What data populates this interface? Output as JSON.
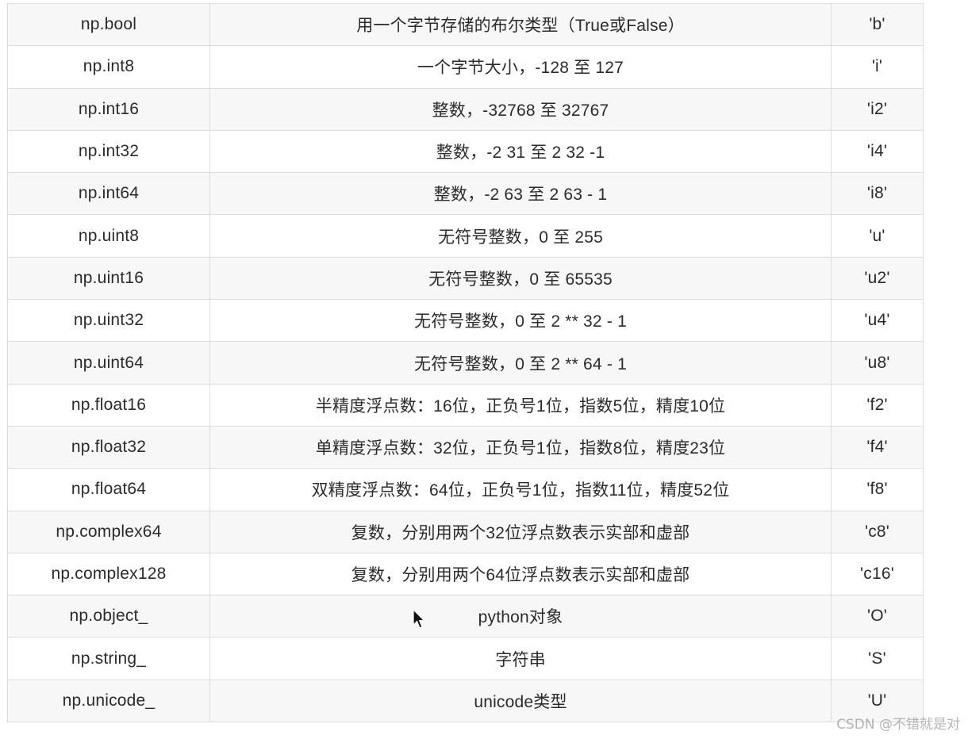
{
  "table": {
    "rows": [
      {
        "type": "np.bool",
        "desc": "用一个字节存储的布尔类型（True或False）",
        "code": "'b'"
      },
      {
        "type": "np.int8",
        "desc": "一个字节大小，-128 至 127",
        "code": "'i'"
      },
      {
        "type": "np.int16",
        "desc": "整数，-32768 至 32767",
        "code": "'i2'"
      },
      {
        "type": "np.int32",
        "desc": "整数，-2 31 至 2 32 -1",
        "code": "'i4'"
      },
      {
        "type": "np.int64",
        "desc": "整数，-2 63 至 2 63 - 1",
        "code": "'i8'"
      },
      {
        "type": "np.uint8",
        "desc": "无符号整数，0 至 255",
        "code": "'u'"
      },
      {
        "type": "np.uint16",
        "desc": "无符号整数，0 至 65535",
        "code": "'u2'"
      },
      {
        "type": "np.uint32",
        "desc": "无符号整数，0 至 2 ** 32 - 1",
        "code": "'u4'"
      },
      {
        "type": "np.uint64",
        "desc": "无符号整数，0 至 2 ** 64 - 1",
        "code": "'u8'"
      },
      {
        "type": "np.float16",
        "desc": "半精度浮点数：16位，正负号1位，指数5位，精度10位",
        "code": "'f2'"
      },
      {
        "type": "np.float32",
        "desc": "单精度浮点数：32位，正负号1位，指数8位，精度23位",
        "code": "'f4'"
      },
      {
        "type": "np.float64",
        "desc": "双精度浮点数：64位，正负号1位，指数11位，精度52位",
        "code": "'f8'"
      },
      {
        "type": "np.complex64",
        "desc": "复数，分别用两个32位浮点数表示实部和虚部",
        "code": "'c8'"
      },
      {
        "type": "np.complex128",
        "desc": "复数，分别用两个64位浮点数表示实部和虚部",
        "code": "'c16'"
      },
      {
        "type": "np.object_",
        "desc": "python对象",
        "code": "'O'"
      },
      {
        "type": "np.string_",
        "desc": "字符串",
        "code": "'S'"
      },
      {
        "type": "np.unicode_",
        "desc": "unicode类型",
        "code": "'U'"
      }
    ]
  },
  "watermark": "CSDN @不错就是对"
}
